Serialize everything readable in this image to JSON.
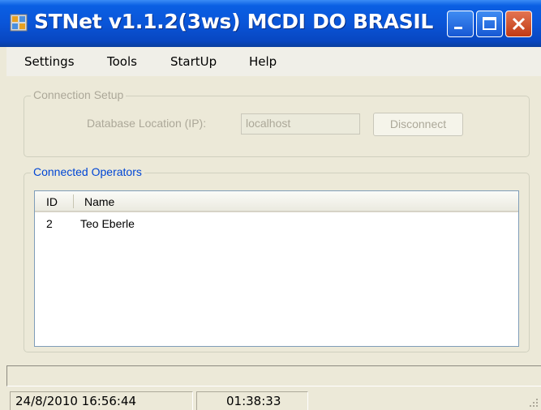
{
  "window": {
    "title": "STNet v1.1.2(3ws) MCDI DO BRASIL",
    "icon": "app-icon",
    "controls": [
      "minimize-icon",
      "maximize-icon",
      "close-icon"
    ]
  },
  "menu": {
    "items": [
      {
        "label": "Settings"
      },
      {
        "label": "Tools"
      },
      {
        "label": "StartUp"
      },
      {
        "label": "Help"
      }
    ]
  },
  "connection_setup": {
    "title": "Connection Setup",
    "db_label": "Database Location (IP):",
    "db_value": "localhost",
    "disconnect_label": "Disconnect",
    "enabled": false
  },
  "operators": {
    "title": "Connected Operators",
    "columns": [
      "ID",
      "Name"
    ],
    "rows": [
      {
        "id": "2",
        "name": "Teo Eberle"
      }
    ]
  },
  "status": {
    "datetime": "24/8/2010 16:56:44",
    "elapsed": "01:38:33"
  },
  "colors": {
    "titlebar": "#0a55d8",
    "window_bg": "#ece9d8",
    "group_title_active": "#0046d5",
    "disabled_text": "#aca899"
  }
}
